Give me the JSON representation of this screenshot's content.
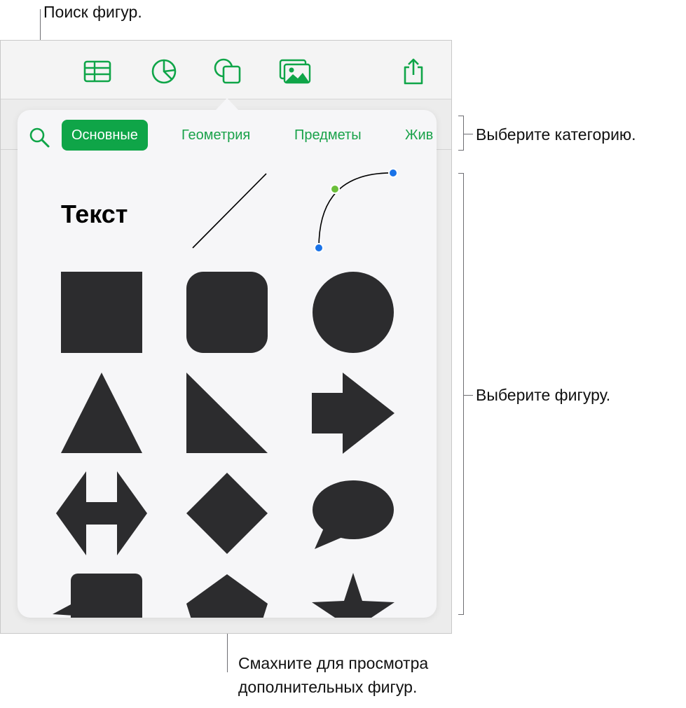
{
  "callouts": {
    "search": "Поиск фигур.",
    "category": "Выберите категорию.",
    "shape": "Выберите фигуру.",
    "swipe_line1": "Смахните для просмотра",
    "swipe_line2": "дополнительных фигур."
  },
  "toolbar": {
    "buttons": [
      "table-icon",
      "chart-icon",
      "shapes-icon",
      "media-icon",
      "share-icon"
    ]
  },
  "tabs": {
    "items": [
      "Основные",
      "Геометрия",
      "Предметы",
      "Жив"
    ],
    "active": "Основные"
  },
  "shapes": {
    "text_label": "Текст"
  },
  "colors": {
    "accent": "#0fa548",
    "shape_fill": "#2c2c2e",
    "handle_blue": "#1a73e8",
    "handle_green": "#6bbf3a"
  }
}
